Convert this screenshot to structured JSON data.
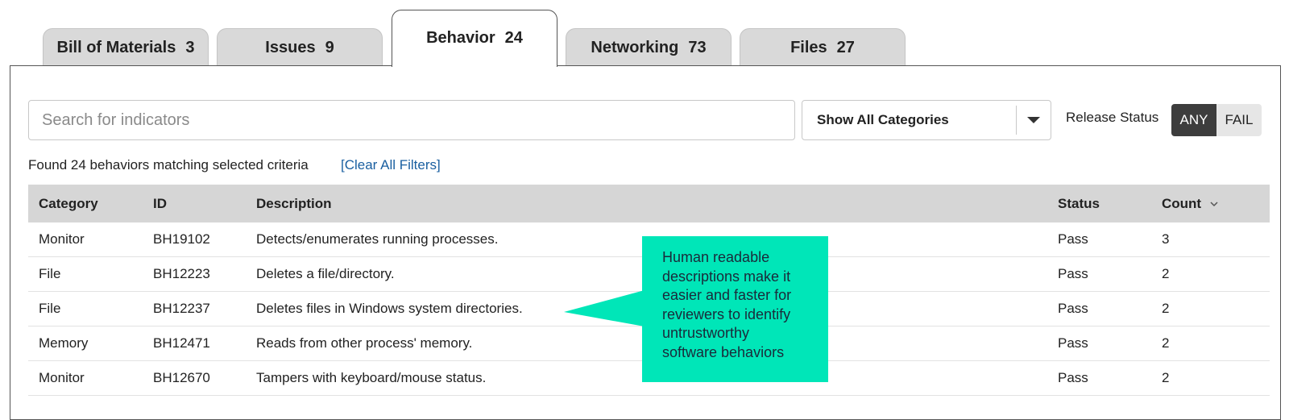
{
  "tabs": [
    {
      "label": "Bill of Materials",
      "count": "3"
    },
    {
      "label": "Issues",
      "count": "9"
    },
    {
      "label": "Behavior",
      "count": "24"
    },
    {
      "label": "Networking",
      "count": "73"
    },
    {
      "label": "Files",
      "count": "27"
    }
  ],
  "search": {
    "placeholder": "Search for indicators",
    "value": ""
  },
  "category_select": {
    "selected": "Show All Categories"
  },
  "release_status": {
    "label": "Release Status",
    "options": [
      "ANY",
      "FAIL"
    ],
    "selected": "ANY"
  },
  "results": {
    "summary": "Found 24 behaviors matching selected criteria",
    "clear_filters": "[Clear All Filters]"
  },
  "table": {
    "columns": [
      "Category",
      "ID",
      "Description",
      "Status",
      "Count"
    ],
    "rows": [
      {
        "category": "Monitor",
        "id": "BH19102",
        "description": "Detects/enumerates running processes.",
        "status": "Pass",
        "count": "3"
      },
      {
        "category": "File",
        "id": "BH12223",
        "description": "Deletes a file/directory.",
        "status": "Pass",
        "count": "2"
      },
      {
        "category": "File",
        "id": "BH12237",
        "description": "Deletes files in Windows system directories.",
        "status": "Pass",
        "count": "2"
      },
      {
        "category": "Memory",
        "id": "BH12471",
        "description": "Reads from other process' memory.",
        "status": "Pass",
        "count": "2"
      },
      {
        "category": "Monitor",
        "id": "BH12670",
        "description": "Tampers with keyboard/mouse status.",
        "status": "Pass",
        "count": "2"
      }
    ]
  },
  "callout": {
    "lines": [
      "Human readable",
      "descriptions make it",
      "easier and faster for",
      "reviewers to identify",
      "untrustworthy",
      "software behaviors"
    ]
  },
  "colors": {
    "callout": "#00e6b8",
    "toggle_active": "#3d3d3d",
    "link": "#1a5fa0",
    "table_header": "#d6d6d6"
  },
  "icons": {
    "select_caret": "caret-down-icon",
    "sort": "chevron-down-icon"
  }
}
